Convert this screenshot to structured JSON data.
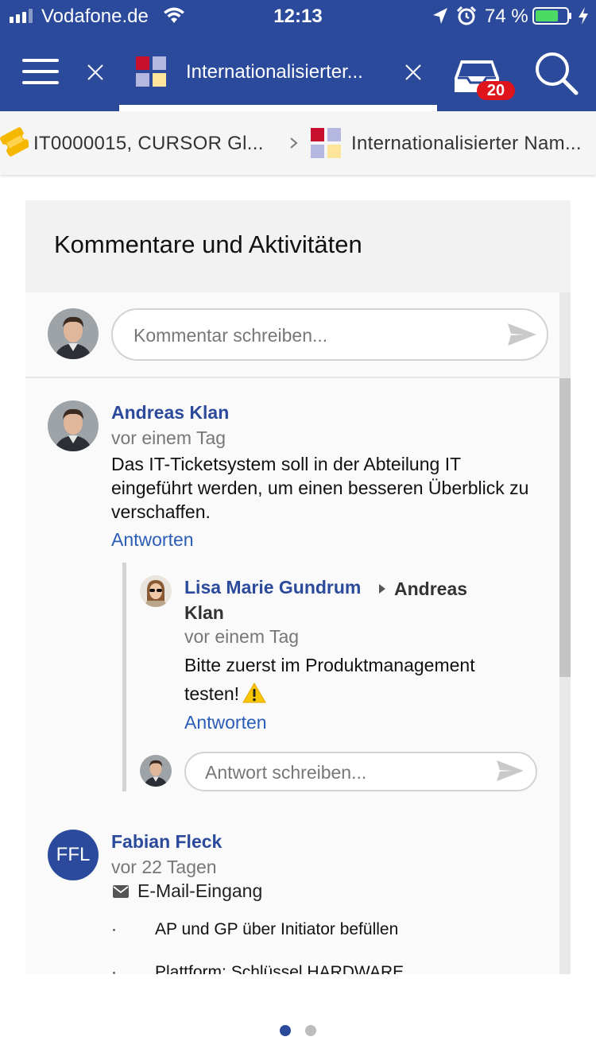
{
  "status_bar": {
    "carrier": "Vodafone.de",
    "time": "12:13",
    "battery_percent": "74 %",
    "battery_level": 0.74
  },
  "nav": {
    "tab_title": "Internationalisierter...",
    "inbox_badge": "20"
  },
  "breadcrumb": {
    "items": [
      {
        "label": "IT0000015, CURSOR Gl...",
        "icon": "ticket-icon"
      },
      {
        "label": "Internationalisierter Nam...",
        "icon": "app-logo-icon"
      }
    ]
  },
  "card": {
    "title": "Kommentare und Aktivitäten",
    "comment_placeholder": "Kommentar schreiben...",
    "reply_placeholder": "Antwort schreiben...",
    "comments": [
      {
        "author": "Andreas Klan",
        "time": "vor einem Tag",
        "text": "Das IT-Ticketsystem soll in der Abteilung IT eingeführt werden, um einen besseren Überblick zu verschaffen.",
        "reply_label": "Antworten",
        "replies": [
          {
            "author": "Lisa Marie Gundrum",
            "target": "Andreas Klan",
            "time": "vor einem Tag",
            "text": "Bitte zuerst im Produktmanagement testen!",
            "reply_label": "Antworten"
          }
        ]
      },
      {
        "author": "Fabian Fleck",
        "initials": "FFL",
        "time": "vor 22 Tagen",
        "source": "E-Mail-Eingang",
        "bullets": [
          "AP und GP über Initiator befüllen",
          "Plattform: Schlüssel HARDWARE"
        ]
      }
    ]
  },
  "pagination": {
    "pages": 2,
    "current": 1
  },
  "colors": {
    "brand": "#2b4a9b",
    "link": "#2b5db8",
    "badge": "#e0141c",
    "battery": "#4cd964"
  }
}
